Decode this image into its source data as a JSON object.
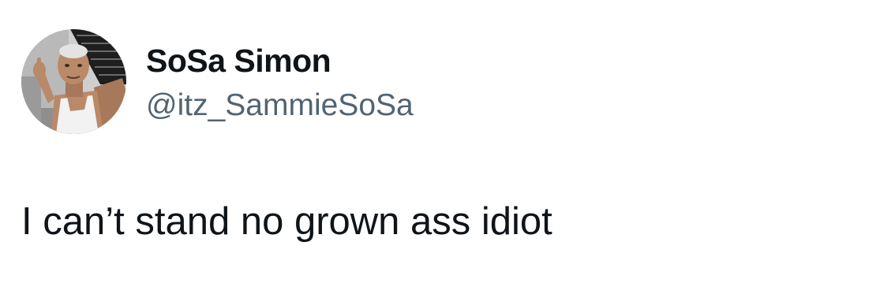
{
  "tweet": {
    "author": {
      "display_name": "SoSa Simon",
      "handle": "@itz_SammieSoSa",
      "avatar": "profile-photo"
    },
    "text": "I can’t stand no grown ass idiot"
  },
  "colors": {
    "background": "#ffffff",
    "primary_text": "#0f1419",
    "secondary_text": "#536471"
  }
}
